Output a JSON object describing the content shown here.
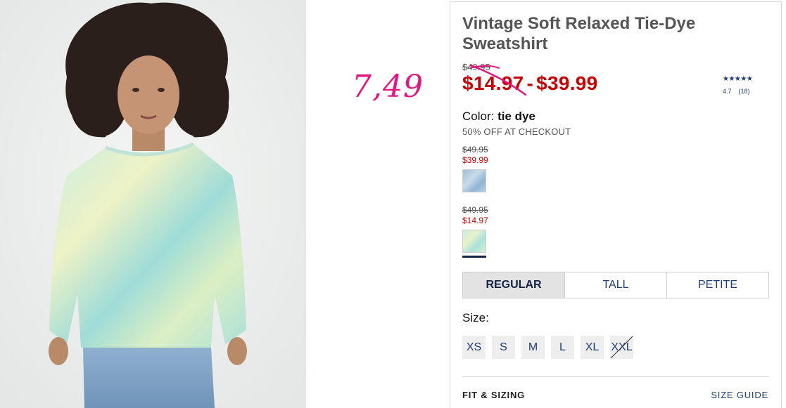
{
  "product": {
    "title": "Vintage Soft Relaxed Tie-Dye Sweatshirt",
    "original_price": "$49.95",
    "price_low": "$14.97",
    "price_separator": "-",
    "price_high": "$39.99",
    "rating": {
      "stars": "★★★★★",
      "value": "4.7",
      "count": "(18)"
    },
    "color_label": "Color:",
    "color_value": "tie dye",
    "promo": "50% OFF AT CHECKOUT"
  },
  "annotation": {
    "handwritten_price": "7,49",
    "color": "#e6157f"
  },
  "variants": [
    {
      "was": "$49.95",
      "now": "$39.99",
      "swatch": "blue tie dye",
      "selected": false
    },
    {
      "was": "$49.95",
      "now": "$14.97",
      "swatch": "mint tie dye",
      "selected": true
    }
  ],
  "fit": {
    "tabs": [
      "REGULAR",
      "TALL",
      "PETITE"
    ],
    "selected": "REGULAR"
  },
  "size": {
    "label": "Size:",
    "options": [
      "XS",
      "S",
      "M",
      "L",
      "XL",
      "XXL"
    ],
    "unavailable": [
      "XXL"
    ]
  },
  "footer": {
    "fit_heading": "FIT & SIZING",
    "size_guide": "SIZE GUIDE"
  },
  "colors": {
    "sale_red": "#cc0000",
    "link_blue": "#1d3d7a",
    "navy": "#122344"
  }
}
